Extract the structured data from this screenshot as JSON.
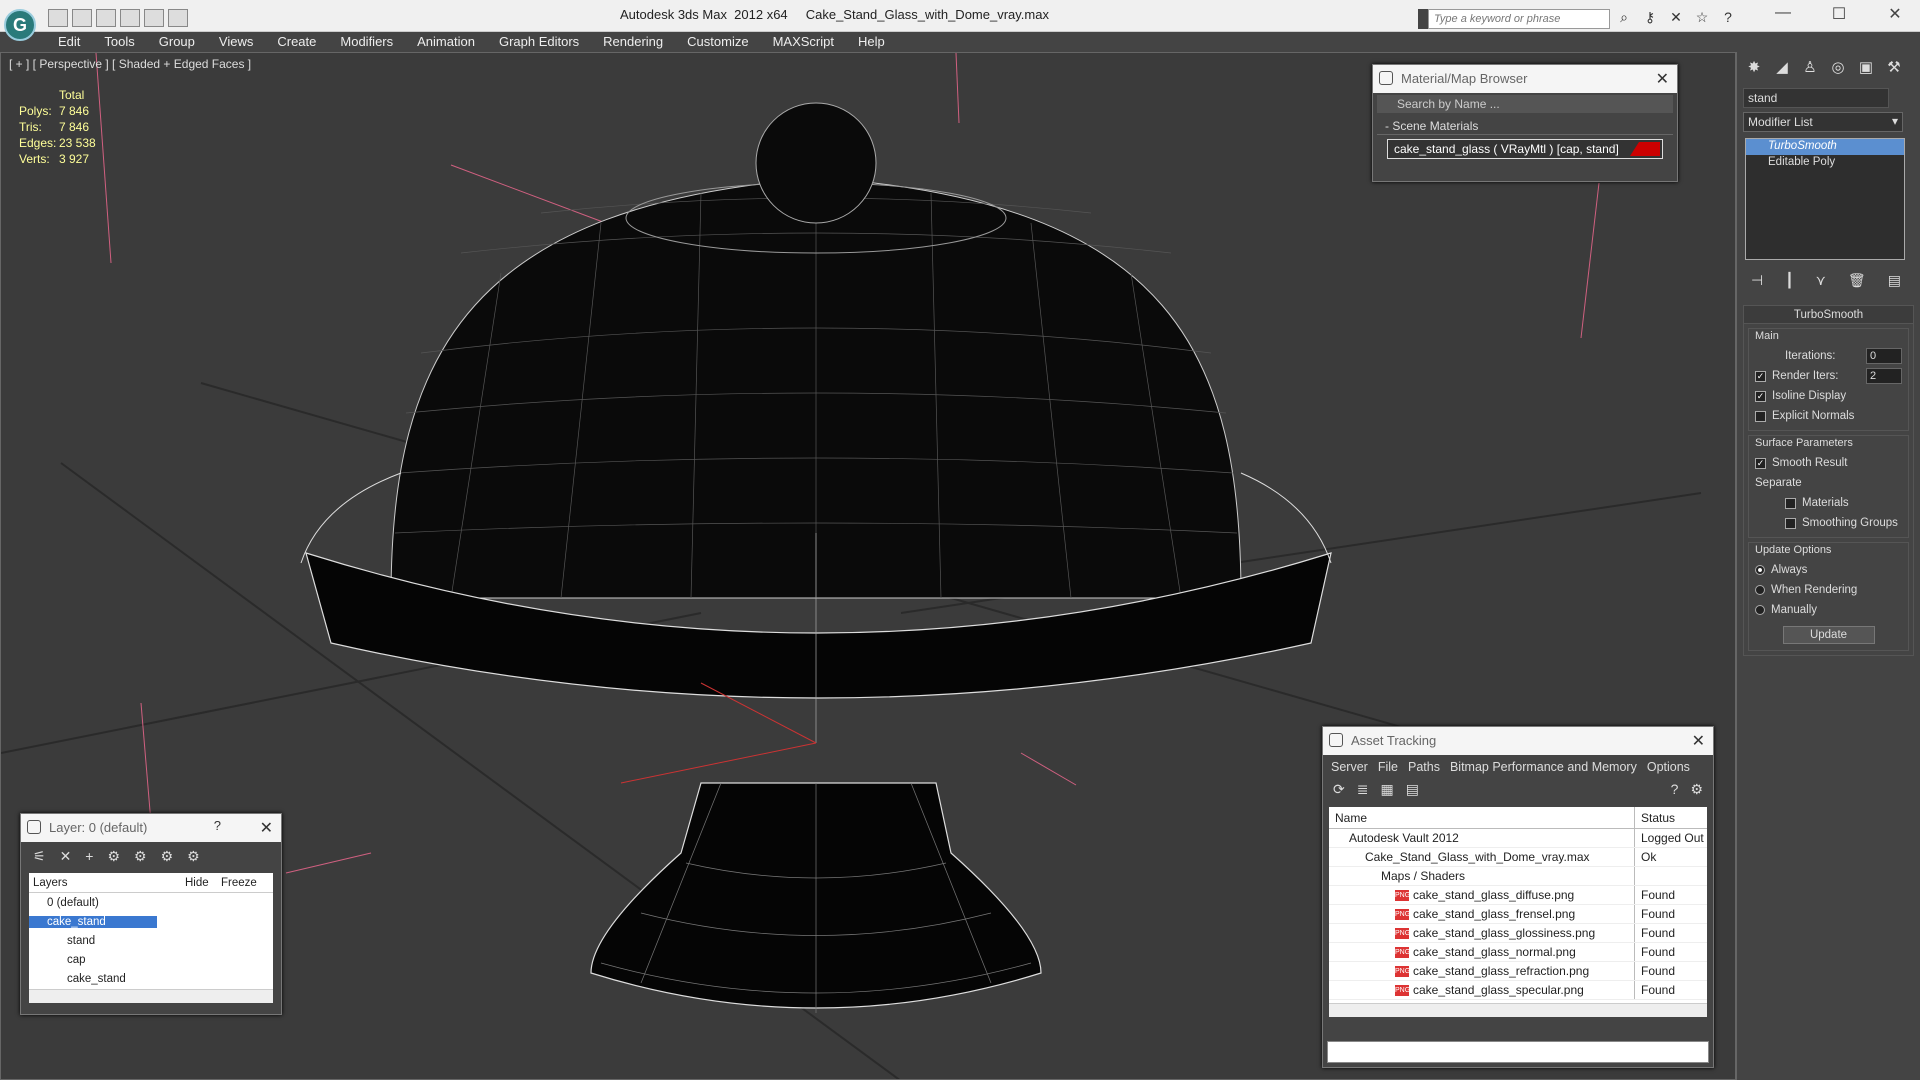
{
  "window": {
    "title": "Autodesk 3ds Max  2012 x64     Cake_Stand_Glass_with_Dome_vray.max",
    "search_placeholder": "Type a keyword or phrase"
  },
  "menu": [
    "Edit",
    "Tools",
    "Group",
    "Views",
    "Create",
    "Modifiers",
    "Animation",
    "Graph Editors",
    "Rendering",
    "Customize",
    "MAXScript",
    "Help"
  ],
  "viewport": {
    "label": "[ + ] [ Perspective ] [ Shaded + Edged Faces ]",
    "stats": {
      "total_label": "Total",
      "rows": [
        {
          "k": "Polys:",
          "v": "7 846"
        },
        {
          "k": "Tris:",
          "v": "7 846"
        },
        {
          "k": "Edges:",
          "v": "23 538"
        },
        {
          "k": "Verts:",
          "v": "3 927"
        }
      ]
    }
  },
  "material_browser": {
    "title": "Material/Map Browser",
    "search_placeholder": "Search by Name ...",
    "section": "- Scene Materials",
    "material": "cake_stand_glass  ( VRayMtl ) [cap, stand]"
  },
  "command_panel": {
    "object_name": "stand",
    "modifier_list": "Modifier List",
    "stack": [
      "TurboSmooth",
      "Editable Poly"
    ],
    "rollout_title": "TurboSmooth",
    "main_label": "Main",
    "iterations_label": "Iterations:",
    "iterations_value": "0",
    "render_iters_label": "Render Iters:",
    "render_iters_value": "2",
    "isoline": "Isoline Display",
    "explicit": "Explicit Normals",
    "surface_label": "Surface Parameters",
    "smooth_result": "Smooth Result",
    "separate": "Separate",
    "materials": "Materials",
    "smoothing_groups": "Smoothing Groups",
    "update_options": "Update Options",
    "always": "Always",
    "when_rendering": "When Rendering",
    "manually": "Manually",
    "update_btn": "Update"
  },
  "layer_panel": {
    "title": "Layer: 0 (default)",
    "headers": [
      "Layers",
      "Hide",
      "Freeze"
    ],
    "rows": [
      "0 (default)",
      "cake_stand",
      "stand",
      "cap",
      "cake_stand"
    ]
  },
  "asset_tracking": {
    "title": "Asset Tracking",
    "menu": [
      "Server",
      "File",
      "Paths",
      "Bitmap Performance and Memory",
      "Options"
    ],
    "headers": [
      "Name",
      "Status"
    ],
    "rows": [
      {
        "name": "Autodesk Vault 2012",
        "status": "Logged Out ..."
      },
      {
        "name": "Cake_Stand_Glass_with_Dome_vray.max",
        "status": "Ok"
      },
      {
        "name": "Maps / Shaders",
        "status": ""
      },
      {
        "name": "cake_stand_glass_diffuse.png",
        "status": "Found"
      },
      {
        "name": "cake_stand_glass_frensel.png",
        "status": "Found"
      },
      {
        "name": "cake_stand_glass_glossiness.png",
        "status": "Found"
      },
      {
        "name": "cake_stand_glass_normal.png",
        "status": "Found"
      },
      {
        "name": "cake_stand_glass_refraction.png",
        "status": "Found"
      },
      {
        "name": "cake_stand_glass_specular.png",
        "status": "Found"
      }
    ]
  }
}
